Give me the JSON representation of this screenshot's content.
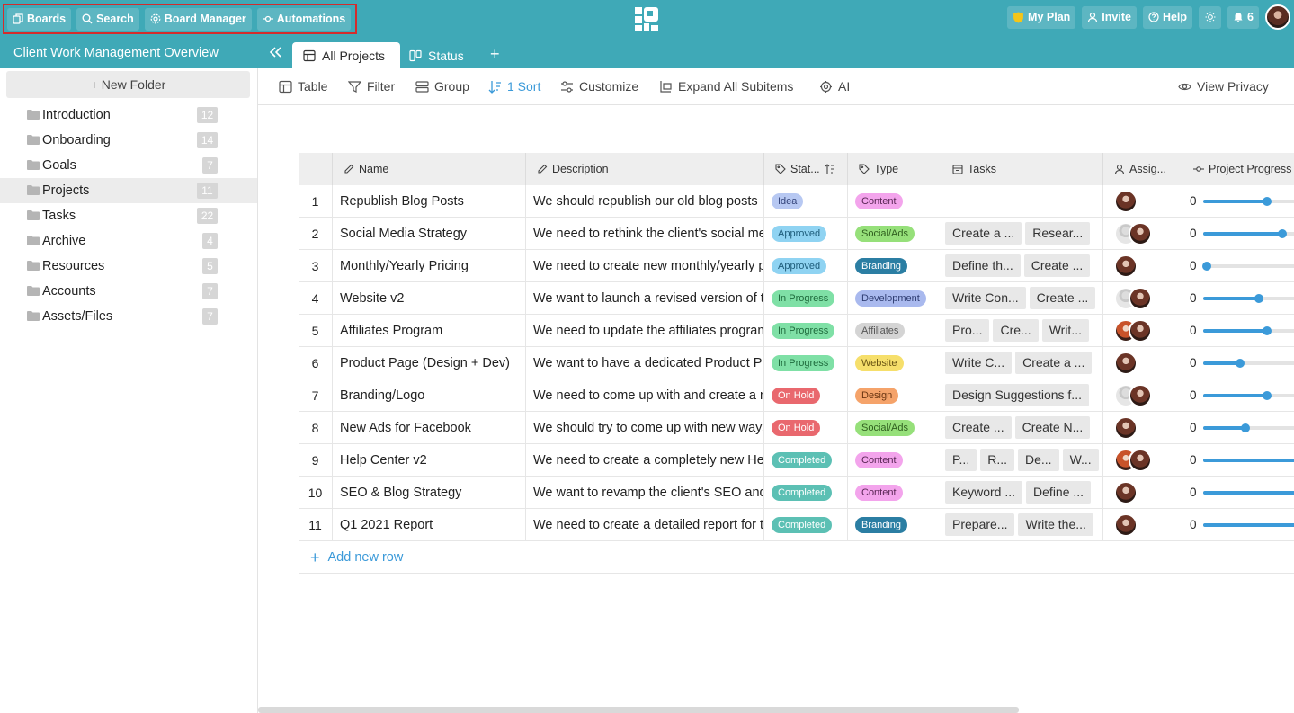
{
  "topbar": {
    "nav": [
      {
        "label": "Boards",
        "icon": "boards-icon"
      },
      {
        "label": "Search",
        "icon": "search-icon"
      },
      {
        "label": "Board Manager",
        "icon": "gear-icon"
      },
      {
        "label": "Automations",
        "icon": "automation-icon"
      }
    ],
    "my_plan": "My Plan",
    "invite": "Invite",
    "help": "Help",
    "notifications": "6",
    "brand_color": "#3fa9b7"
  },
  "workspace": {
    "title": "Client Work Management Overview",
    "tabs": [
      {
        "label": "All Projects",
        "active": true
      },
      {
        "label": "Status",
        "active": false
      }
    ],
    "add_tab": "+"
  },
  "sidebar": {
    "new_folder": "+ New Folder",
    "folders": [
      {
        "name": "Introduction",
        "count": "12"
      },
      {
        "name": "Onboarding",
        "count": "14"
      },
      {
        "name": "Goals",
        "count": "7"
      },
      {
        "name": "Projects",
        "count": "11",
        "selected": true
      },
      {
        "name": "Tasks",
        "count": "22"
      },
      {
        "name": "Archive",
        "count": "4"
      },
      {
        "name": "Resources",
        "count": "5"
      },
      {
        "name": "Accounts",
        "count": "7"
      },
      {
        "name": "Assets/Files",
        "count": "7"
      }
    ]
  },
  "toolbar": {
    "table": "Table",
    "filter": "Filter",
    "group": "Group",
    "sort": "1 Sort",
    "customize": "Customize",
    "expand": "Expand All Subitems",
    "ai": "AI",
    "view_privacy": "View Privacy"
  },
  "table": {
    "headers": {
      "name": "Name",
      "description": "Description",
      "status": "Stat...",
      "type": "Type",
      "tasks": "Tasks",
      "assignee": "Assig...",
      "progress": "Project Progress"
    },
    "rows": [
      {
        "num": "1",
        "name": "Republish Blog Posts",
        "description": "We should republish our old blog posts",
        "status": "Idea",
        "type": "Content",
        "tasks": [],
        "assignees": [
          "photo"
        ],
        "progress_label": "0",
        "progress": 0.65
      },
      {
        "num": "2",
        "name": "Social Media Strategy",
        "description": "We need to rethink the client's social media",
        "status": "Approved",
        "type": "Social/Ads",
        "tasks": [
          "Create a ...",
          "Resear..."
        ],
        "assignees": [
          "grey",
          "photo"
        ],
        "progress_label": "0",
        "progress": 0.8
      },
      {
        "num": "3",
        "name": "Monthly/Yearly Pricing",
        "description": "We need to create new monthly/yearly pricing",
        "status": "Approved",
        "type": "Branding",
        "tasks": [
          "Define th...",
          "Create ..."
        ],
        "assignees": [
          "photo"
        ],
        "progress_label": "0",
        "progress": 0.04
      },
      {
        "num": "4",
        "name": "Website v2",
        "description": "We want to launch a revised version of the",
        "status": "In Progress",
        "type": "Development",
        "tasks": [
          "Write Con...",
          "Create ..."
        ],
        "assignees": [
          "grey",
          "photo"
        ],
        "progress_label": "0",
        "progress": 0.57
      },
      {
        "num": "5",
        "name": "Affiliates Program",
        "description": "We need to update the affiliates program",
        "status": "In Progress",
        "type": "Affiliates",
        "tasks": [
          "Pro...",
          "Cre...",
          "Writ..."
        ],
        "assignees": [
          "mixed",
          "photo"
        ],
        "progress_label": "0",
        "progress": 0.65
      },
      {
        "num": "6",
        "name": "Product Page (Design + Dev)",
        "description": "We want to have a dedicated Product Page",
        "status": "In Progress",
        "type": "Website",
        "tasks": [
          "Write C...",
          "Create a ..."
        ],
        "assignees": [
          "photo"
        ],
        "progress_label": "0",
        "progress": 0.38
      },
      {
        "num": "7",
        "name": "Branding/Logo",
        "description": "We need to come up with and create a new",
        "status": "On Hold",
        "type": "Design",
        "tasks": [
          "Design Suggestions f..."
        ],
        "assignees": [
          "grey",
          "photo"
        ],
        "progress_label": "0",
        "progress": 0.65
      },
      {
        "num": "8",
        "name": "New Ads for Facebook",
        "description": "We should try to come up with new ways",
        "status": "On Hold",
        "type": "Social/Ads",
        "tasks": [
          "Create ...",
          "Create N..."
        ],
        "assignees": [
          "photo"
        ],
        "progress_label": "0",
        "progress": 0.43
      },
      {
        "num": "9",
        "name": "Help Center v2",
        "description": "We need to create a completely new Help",
        "status": "Completed",
        "type": "Content",
        "tasks": [
          "P...",
          "R...",
          "De...",
          "W..."
        ],
        "assignees": [
          "mixed",
          "photo"
        ],
        "progress_label": "0",
        "progress": 1.0
      },
      {
        "num": "10",
        "name": "SEO & Blog Strategy",
        "description": "We want to revamp the client's SEO and",
        "status": "Completed",
        "type": "Content",
        "tasks": [
          "Keyword ...",
          "Define ..."
        ],
        "assignees": [
          "photo"
        ],
        "progress_label": "0",
        "progress": 1.0
      },
      {
        "num": "11",
        "name": "Q1 2021 Report",
        "description": "We need to create a detailed report for the",
        "status": "Completed",
        "type": "Branding",
        "tasks": [
          "Prepare...",
          "Write the..."
        ],
        "assignees": [
          "photo"
        ],
        "progress_label": "0",
        "progress": 1.0
      }
    ],
    "add_row": "Add new row"
  },
  "status_colors": {
    "Idea": {
      "bg": "#b7c8f2",
      "fg": "#34447a"
    },
    "Approved": {
      "bg": "#8fd3f2",
      "fg": "#1d5c7a"
    },
    "In Progress": {
      "bg": "#7fe0a6",
      "fg": "#1e6a3c"
    },
    "On Hold": {
      "bg": "#e9686e",
      "fg": "#ffffff"
    },
    "Completed": {
      "bg": "#5cc0b4",
      "fg": "#ffffff"
    }
  },
  "type_colors": {
    "Content": {
      "bg": "#f3a4ec",
      "fg": "#5a2655"
    },
    "Social/Ads": {
      "bg": "#96e07a",
      "fg": "#2f5e1f"
    },
    "Branding": {
      "bg": "#2b7ea3",
      "fg": "#ffffff"
    },
    "Development": {
      "bg": "#a9b9ee",
      "fg": "#2f3d72"
    },
    "Affiliates": {
      "bg": "#d4d4d4",
      "fg": "#555555"
    },
    "Website": {
      "bg": "#f6df6b",
      "fg": "#6a5514"
    },
    "Design": {
      "bg": "#f5a36a",
      "fg": "#6b3613"
    }
  }
}
